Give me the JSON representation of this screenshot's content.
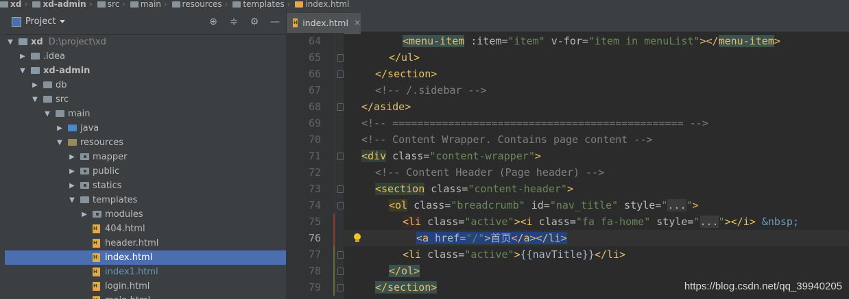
{
  "breadcrumb": [
    {
      "label": "xd",
      "bold": true,
      "icon": "module-icon"
    },
    {
      "label": "xd-admin",
      "bold": true,
      "icon": "module-icon"
    },
    {
      "label": "src",
      "bold": false,
      "icon": "folder-icon"
    },
    {
      "label": "main",
      "bold": false,
      "icon": "folder-icon"
    },
    {
      "label": "resources",
      "bold": false,
      "icon": "folder-icon"
    },
    {
      "label": "templates",
      "bold": false,
      "icon": "folder-icon"
    },
    {
      "label": "index.html",
      "bold": false,
      "icon": "html-file-icon"
    }
  ],
  "project_panel": {
    "title": "Project",
    "tools": [
      {
        "name": "locate-icon",
        "glyph": "⊕"
      },
      {
        "name": "collapse-all-icon",
        "glyph": "≑"
      },
      {
        "name": "gear-icon",
        "glyph": "⚙"
      },
      {
        "name": "minimize-icon",
        "glyph": "—"
      }
    ],
    "tree": [
      {
        "label": "xd",
        "path": "D:\\project\\xd",
        "depth": 0,
        "arrow": "down",
        "icon": "module",
        "bold": true
      },
      {
        "label": ".idea",
        "depth": 1,
        "arrow": "right",
        "icon": "folder"
      },
      {
        "label": "xd-admin",
        "depth": 1,
        "arrow": "down",
        "icon": "module",
        "bold": true
      },
      {
        "label": "db",
        "depth": 2,
        "arrow": "right",
        "icon": "folder"
      },
      {
        "label": "src",
        "depth": 2,
        "arrow": "down",
        "icon": "folder"
      },
      {
        "label": "main",
        "depth": 3,
        "arrow": "down",
        "icon": "folder"
      },
      {
        "label": "java",
        "depth": 4,
        "arrow": "right",
        "icon": "srcfolder"
      },
      {
        "label": "resources",
        "depth": 4,
        "arrow": "down",
        "icon": "resfolder"
      },
      {
        "label": "mapper",
        "depth": 5,
        "arrow": "right",
        "icon": "pkg"
      },
      {
        "label": "public",
        "depth": 5,
        "arrow": "right",
        "icon": "pkg"
      },
      {
        "label": "statics",
        "depth": 5,
        "arrow": "right",
        "icon": "pkg"
      },
      {
        "label": "templates",
        "depth": 5,
        "arrow": "down",
        "icon": "folder"
      },
      {
        "label": "modules",
        "depth": 6,
        "arrow": "right",
        "icon": "pkg"
      },
      {
        "label": "404.html",
        "depth": 6,
        "arrow": "",
        "icon": "html"
      },
      {
        "label": "header.html",
        "depth": 6,
        "arrow": "",
        "icon": "html"
      },
      {
        "label": "index.html",
        "depth": 6,
        "arrow": "",
        "icon": "html",
        "selected": true
      },
      {
        "label": "index1.html",
        "depth": 6,
        "arrow": "",
        "icon": "html",
        "unversioned": true
      },
      {
        "label": "login.html",
        "depth": 6,
        "arrow": "",
        "icon": "html"
      },
      {
        "label": "main.html",
        "depth": 6,
        "arrow": "",
        "icon": "html"
      }
    ]
  },
  "editor": {
    "tab_label": "index.html",
    "tab_close": "×",
    "current_line": 76,
    "lines": [
      {
        "num": 64,
        "indent": 3,
        "segs": [
          [
            "t hl-tag",
            "<menu-item"
          ],
          [
            "a",
            " :item="
          ],
          [
            "v",
            "\"item\""
          ],
          [
            "a",
            " v-for="
          ],
          [
            "v",
            "\"item in menuList\""
          ],
          [
            "t",
            "></"
          ],
          [
            "t hl-tag",
            "menu-item"
          ],
          [
            "t",
            ">"
          ]
        ]
      },
      {
        "num": 65,
        "indent": 2,
        "segs": [
          [
            "t",
            "</ul>"
          ]
        ]
      },
      {
        "num": 66,
        "indent": 1,
        "segs": [
          [
            "t",
            "</section>"
          ]
        ]
      },
      {
        "num": 67,
        "indent": 1,
        "segs": [
          [
            "c",
            "<!-- /.sidebar -->"
          ]
        ]
      },
      {
        "num": 68,
        "indent": 0,
        "segs": [
          [
            "t",
            "</aside>"
          ]
        ]
      },
      {
        "num": 69,
        "indent": 0,
        "segs": [
          [
            "c",
            "<!-- =============================================== -->"
          ]
        ]
      },
      {
        "num": 70,
        "indent": 0,
        "segs": [
          [
            "c",
            "<!-- Content Wrapper. Contains page content -->"
          ]
        ]
      },
      {
        "num": 71,
        "indent": 0,
        "segs": [
          [
            "t tag-bg-a",
            "<div"
          ],
          [
            "a",
            " class="
          ],
          [
            "v",
            "\"content-wrapper\""
          ],
          [
            "t",
            ">"
          ]
        ]
      },
      {
        "num": 72,
        "indent": 1,
        "segs": [
          [
            "c",
            "<!-- Content Header (Page header) -->"
          ]
        ]
      },
      {
        "num": 73,
        "indent": 1,
        "segs": [
          [
            "t tag-bg-a",
            "<section"
          ],
          [
            "a",
            " class="
          ],
          [
            "v",
            "\"content-header\""
          ],
          [
            "t",
            ">"
          ]
        ]
      },
      {
        "num": 74,
        "indent": 2,
        "segs": [
          [
            "t tag-bg-b",
            "<ol"
          ],
          [
            "a",
            " class="
          ],
          [
            "v",
            "\"breadcrumb\""
          ],
          [
            "a",
            " id="
          ],
          [
            "v",
            "\"nav_title\""
          ],
          [
            "a",
            " style="
          ],
          [
            "v",
            "\""
          ],
          [
            "fold-inline",
            "..."
          ],
          [
            "v",
            "\""
          ],
          [
            "t",
            ">"
          ]
        ]
      },
      {
        "num": 75,
        "indent": 3,
        "segs": [
          [
            "t tag-bg-c",
            "<li"
          ],
          [
            "a",
            " class="
          ],
          [
            "v",
            "\"active\""
          ],
          [
            "t",
            "><i"
          ],
          [
            "a",
            " class="
          ],
          [
            "v",
            "\"fa fa-home\""
          ],
          [
            "a",
            " style="
          ],
          [
            "v",
            "\""
          ],
          [
            "fold-inline",
            "..."
          ],
          [
            "v",
            "\""
          ],
          [
            "t",
            "></i>"
          ],
          [
            "p",
            " "
          ],
          [
            "ent",
            "&nbsp;"
          ]
        ]
      },
      {
        "num": 76,
        "indent": 4,
        "segs": [
          [
            "t sel",
            "<a"
          ],
          [
            "a sel",
            " href="
          ],
          [
            "v sel",
            "\"/\""
          ],
          [
            "t sel",
            ">"
          ],
          [
            "p sel",
            "首页"
          ],
          [
            "t sel",
            "</a></li>"
          ]
        ]
      },
      {
        "num": 77,
        "indent": 3,
        "segs": [
          [
            "t",
            "<li"
          ],
          [
            "a",
            " class="
          ],
          [
            "v",
            "\"active\""
          ],
          [
            "t",
            ">"
          ],
          [
            "p",
            "{{navTitle}}"
          ],
          [
            "t",
            "</li>"
          ]
        ]
      },
      {
        "num": 78,
        "indent": 2,
        "segs": [
          [
            "t hl-pair",
            "</ol>"
          ]
        ]
      },
      {
        "num": 79,
        "indent": 1,
        "segs": [
          [
            "t hl-pair",
            "</section>"
          ]
        ]
      }
    ]
  },
  "watermark": "https://blog.csdn.net/qq_39940205"
}
